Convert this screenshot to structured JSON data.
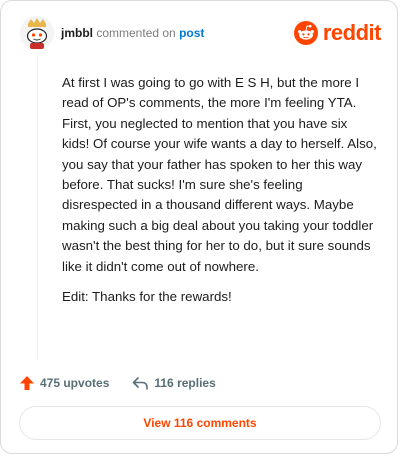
{
  "header": {
    "username": "jmbbl",
    "action_text": "commented on",
    "post_link": "post",
    "brand": "reddit"
  },
  "comment": {
    "paragraphs": [
      "At first I was going to go with E S H, but the more I read of OP's comments, the more I'm feeling YTA. First, you neglected to mention that you have six kids! Of course your wife wants a day to herself. Also, you say that your father has spoken to her this way before. That sucks! I'm sure she's feeling disrespected in a thousand different ways. Maybe making such a big deal about you taking your toddler wasn't the best thing for her to do, but it sure sounds like it didn't come out of nowhere.",
      "Edit: Thanks for the rewards!"
    ]
  },
  "actions": {
    "upvotes": "475 upvotes",
    "replies": "116 replies"
  },
  "footer": {
    "view_comments": "View 116 comments"
  },
  "colors": {
    "brand": "#ff4500",
    "link": "#0079d3",
    "muted": "#576f76"
  },
  "icons": [
    "reddit-avatar-icon",
    "reddit-logo-icon",
    "upvote-arrow-icon",
    "reply-arrow-icon"
  ]
}
